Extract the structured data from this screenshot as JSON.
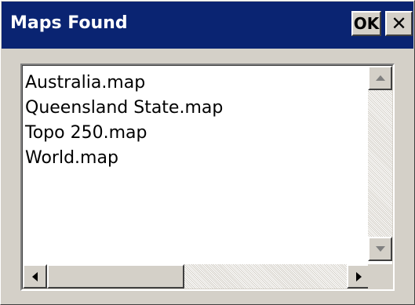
{
  "dialog": {
    "title": "Maps Found",
    "ok_label": "OK",
    "close_label": "✕"
  },
  "map_list": {
    "items": [
      "Australia.map",
      "Queensland State.map",
      "Topo 250.map",
      "World.map"
    ]
  },
  "scrollbars": {
    "vertical": {
      "up_icon": "scroll-up-arrow",
      "down_icon": "scroll-down-arrow",
      "enabled": false
    },
    "horizontal": {
      "left_icon": "scroll-left-arrow",
      "right_icon": "scroll-right-arrow",
      "enabled": true
    }
  },
  "colors": {
    "titlebar": "#0a2472",
    "title_text": "#ffffff",
    "face": "#d4d0c8",
    "list_background": "#ffffff"
  }
}
